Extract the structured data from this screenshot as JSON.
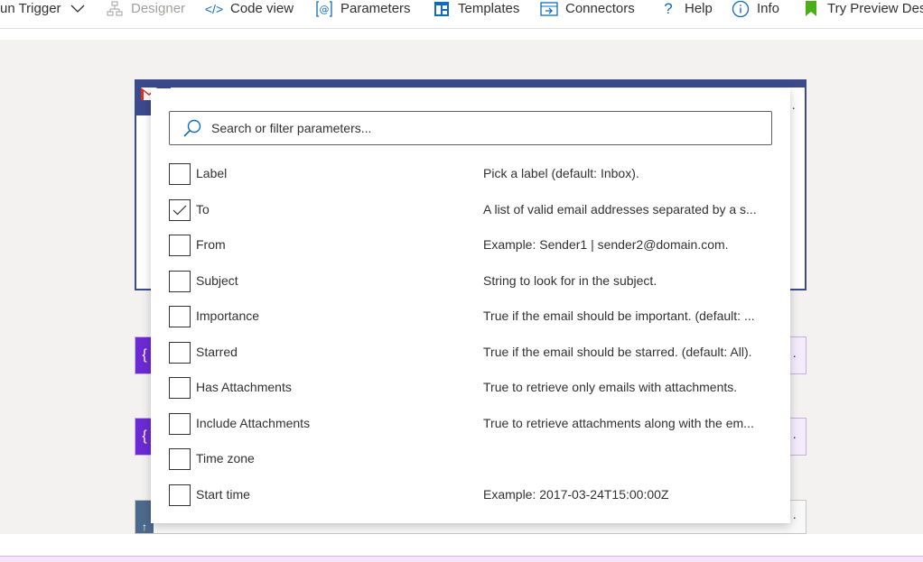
{
  "toolbar": {
    "items": [
      {
        "label": "un Trigger",
        "icon": "chevron-down-icon"
      },
      {
        "label": "Designer",
        "icon": "designer-icon",
        "disabled": true
      },
      {
        "label": "Code view",
        "icon": "code-icon"
      },
      {
        "label": "Parameters",
        "icon": "parameters-icon"
      },
      {
        "label": "Templates",
        "icon": "templates-icon"
      },
      {
        "label": "Connectors",
        "icon": "connectors-icon"
      },
      {
        "label": "Help",
        "icon": "help-icon"
      },
      {
        "label": "Info",
        "icon": "info-icon"
      },
      {
        "label": "Try Preview Des",
        "icon": "preview-flag-icon"
      }
    ]
  },
  "colors": {
    "accent": "#0f6cbd",
    "gmail_card": "#3b4a8c",
    "variable": "#6c2ad4",
    "preview_flag": "#4caf1a"
  },
  "search": {
    "placeholder": "Search or filter parameters..."
  },
  "parameters": [
    {
      "name": "Label",
      "description": "Pick a label (default: Inbox).",
      "checked": false
    },
    {
      "name": "To",
      "description": "A list of valid email addresses separated by a s...",
      "checked": true
    },
    {
      "name": "From",
      "description": "Example: Sender1 | sender2@domain.com.",
      "checked": false
    },
    {
      "name": "Subject",
      "description": "String to look for in the subject.",
      "checked": false
    },
    {
      "name": "Importance",
      "description": "True if the email should be important. (default: ...",
      "checked": false
    },
    {
      "name": "Starred",
      "description": "True if the email should be starred. (default: All).",
      "checked": false
    },
    {
      "name": "Has Attachments",
      "description": "True to retrieve only emails with attachments.",
      "checked": false
    },
    {
      "name": "Include Attachments",
      "description": "True to retrieve attachments along with the em...",
      "checked": false
    },
    {
      "name": "Time zone",
      "description": "",
      "checked": false
    },
    {
      "name": "Start time",
      "description": "Example: 2017-03-24T15:00:00Z",
      "checked": false
    }
  ],
  "canvas": {
    "variable_glyph": "{",
    "more_glyph": "·",
    "bottom_glyph": "↑"
  }
}
